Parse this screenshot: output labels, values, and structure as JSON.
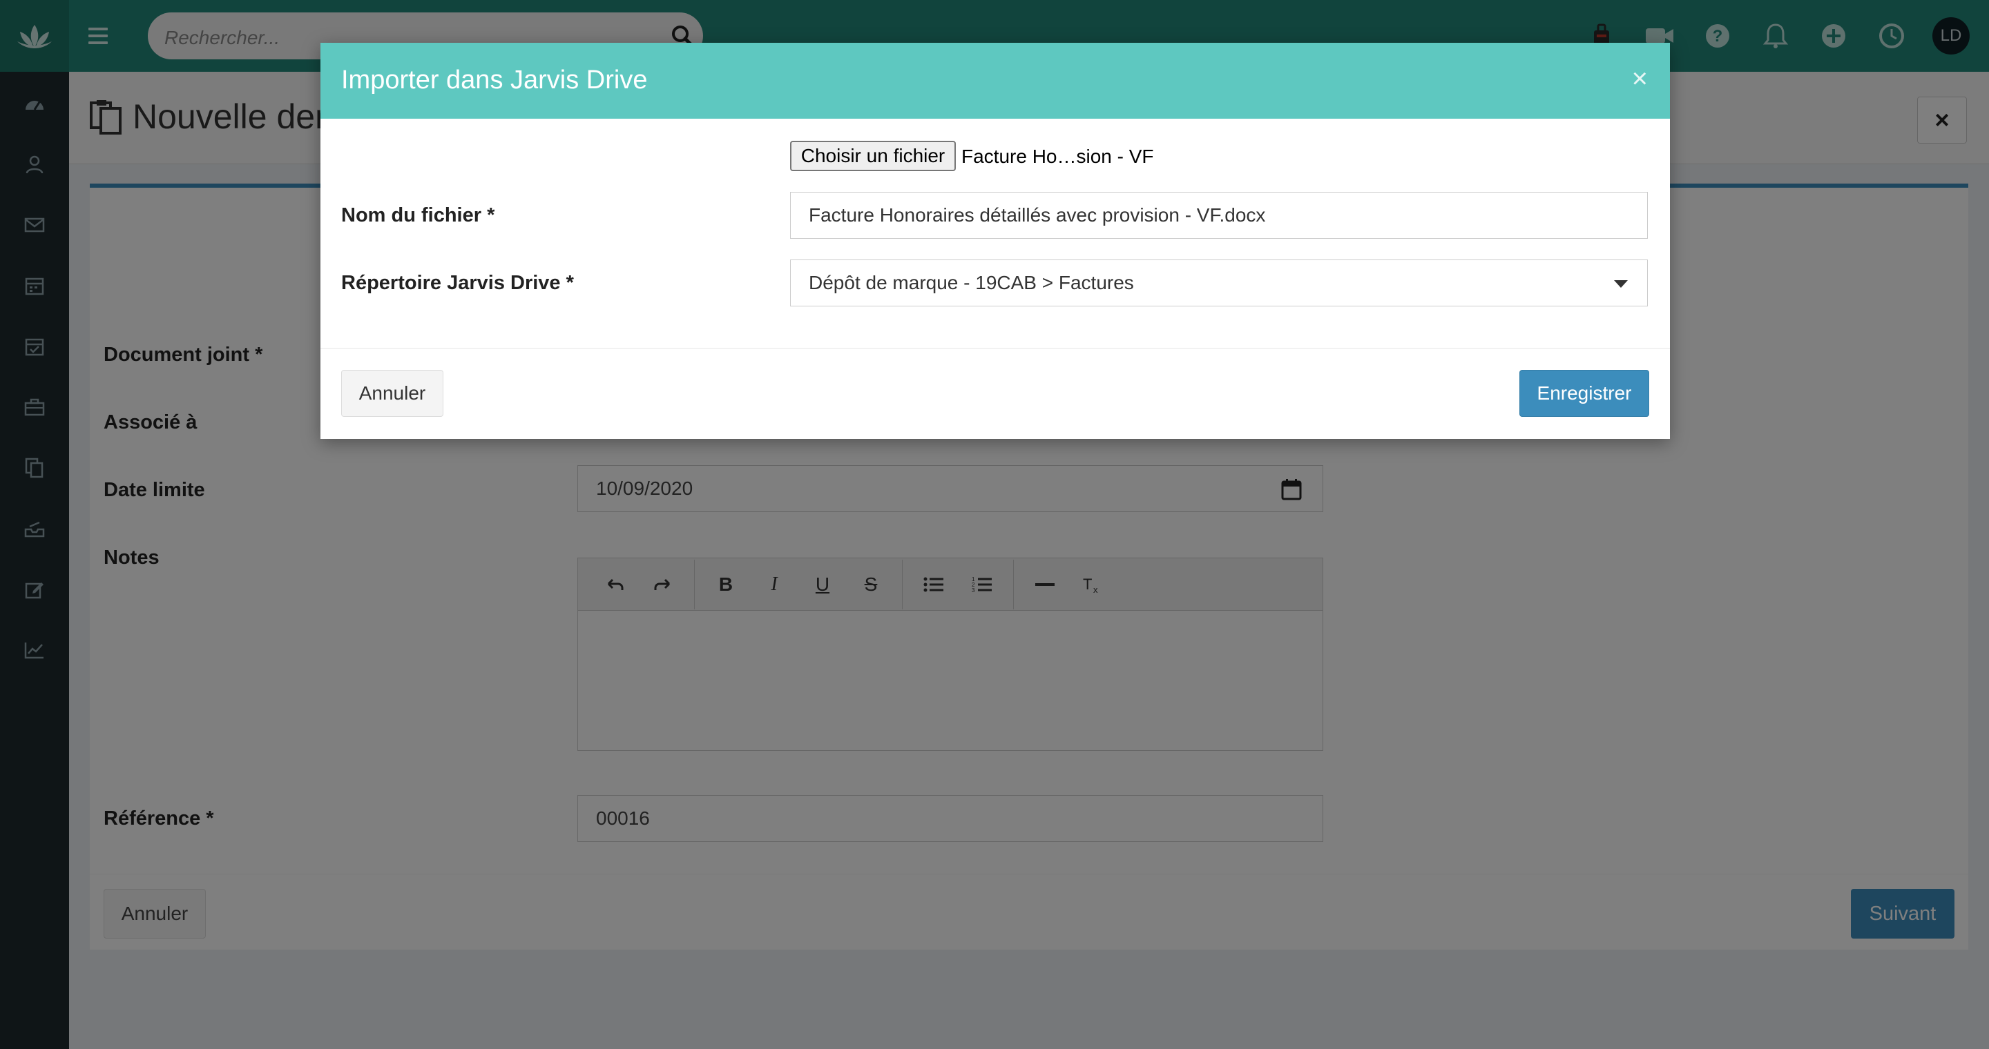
{
  "topbar": {
    "search_placeholder": "Rechercher...",
    "user_initials": "LD",
    "icons": [
      "bag-icon",
      "video-icon",
      "help-icon",
      "bell-icon",
      "plus-icon",
      "clock-icon"
    ],
    "colors": {
      "bar": "#23887a",
      "logo_bg": "#1d7467"
    }
  },
  "sidebar": {
    "icons": [
      "dashboard-icon",
      "contacts-icon",
      "mail-icon",
      "calendar-icon",
      "calendar-check-icon",
      "briefcase-icon",
      "documents-icon",
      "inbox-icon",
      "edit-icon",
      "chart-icon"
    ]
  },
  "page": {
    "title": "Nouvelle den",
    "close_label": "×"
  },
  "form": {
    "document_label": "Document joint *",
    "associated_label": "Associé à",
    "date_label": "Date limite",
    "date_value": "10/09/2020",
    "notes_label": "Notes",
    "reference_label": "Référence *",
    "reference_value": "00016",
    "cancel_label": "Annuler",
    "next_label": "Suivant"
  },
  "modal": {
    "title": "Importer dans Jarvis Drive",
    "close_label": "×",
    "choose_file_label": "Choisir un fichier",
    "chosen_file": "Facture Ho…sion - VF",
    "filename_label": "Nom du fichier *",
    "filename_value": "Facture Honoraires détaillés avec provision - VF.docx",
    "directory_label": "Répertoire Jarvis Drive *",
    "directory_value": "Dépôt de marque - 19CAB > Factures",
    "cancel_label": "Annuler",
    "save_label": "Enregistrer",
    "header_color": "#5ec8c0",
    "save_color": "#3c8dbc"
  }
}
